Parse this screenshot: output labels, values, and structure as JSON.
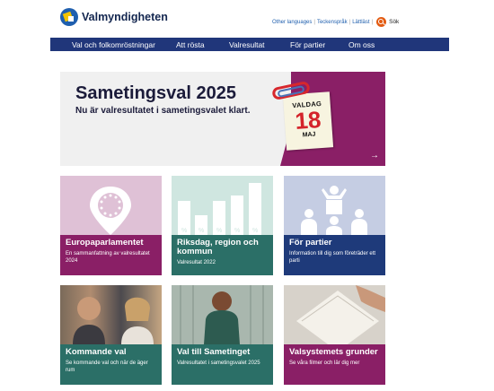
{
  "header": {
    "logo_text": "Valmyndigheten",
    "links": [
      "Other languages",
      "Teckenspråk",
      "Lättläst"
    ],
    "search_label": "Sök"
  },
  "nav": [
    "Val och folkomröstningar",
    "Att rösta",
    "Valresultat",
    "För partier",
    "Om oss"
  ],
  "hero": {
    "title": "Sametingsval 2025",
    "subtitle": "Nu är valresultatet i sametingsvalet klart.",
    "calendar": {
      "top": "VALDAG",
      "day": "18",
      "month": "MAJ"
    }
  },
  "cards": [
    {
      "title": "Europaparlamentet",
      "desc": "En sammanfattning av valresultatet 2024"
    },
    {
      "title": "Riksdag, region och kommun",
      "desc": "Valresultat 2022"
    },
    {
      "title": "För partier",
      "desc": "Information till dig som företräder ett parti"
    },
    {
      "title": "Kommande val",
      "desc": "Se kommande val och när de äger rum"
    },
    {
      "title": "Val till Sametinget",
      "desc": "Valresultatet i sametingsvalet 2025"
    },
    {
      "title": "Valsystemets grunder",
      "desc": "Se våra filmer och lär dig mer"
    }
  ],
  "colors": {
    "nav": "#20367a",
    "magenta": "#8a1f66",
    "teal": "#2b6f67",
    "navy": "#1e3a7a",
    "search": "#e35b12"
  }
}
